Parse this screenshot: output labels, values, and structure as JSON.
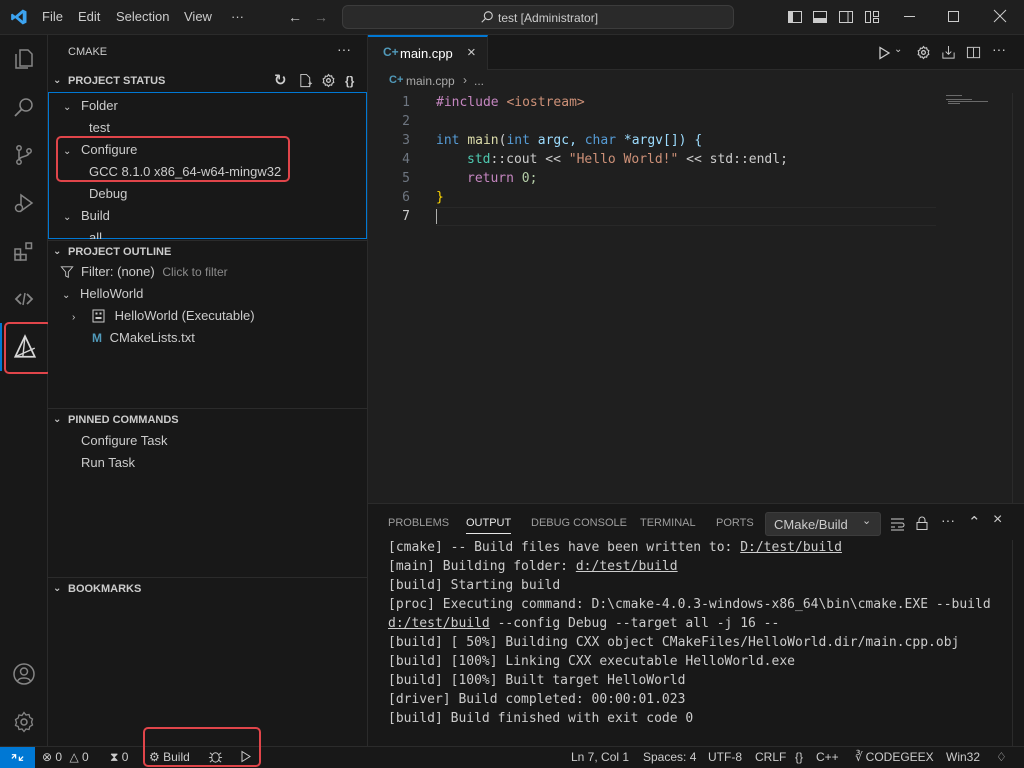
{
  "titlebar": {
    "menus": [
      "File",
      "Edit",
      "Selection",
      "View",
      "···"
    ],
    "search_text": "test [Administrator]"
  },
  "sidebar": {
    "title": "CMAKE",
    "more": "···",
    "project_status": {
      "header": "PROJECT STATUS",
      "folder_label": "Folder",
      "folder_value": "test",
      "configure_label": "Configure",
      "configure_value": "GCC 8.1.0 x86_64-w64-mingw32",
      "configure_value2": "Debug",
      "build_label": "Build",
      "build_value": "all"
    },
    "project_outline": {
      "header": "PROJECT OUTLINE",
      "filter_label": "Filter: (none)",
      "filter_hint": "Click to filter",
      "project": "HelloWorld",
      "target": "HelloWorld (Executable)",
      "file": "CMakeLists.txt"
    },
    "pinned": {
      "header": "PINNED COMMANDS",
      "items": [
        "Configure Task",
        "Run Task"
      ]
    },
    "bookmarks": {
      "header": "BOOKMARKS"
    }
  },
  "editor": {
    "tab_label": "main.cpp",
    "breadcrumb_file": "main.cpp",
    "breadcrumb_more": "...",
    "line_numbers": [
      "1",
      "2",
      "3",
      "4",
      "5",
      "6",
      "7"
    ],
    "code": {
      "l1_pre": "#include",
      "l1_inc": "<iostream>",
      "l3_int": "int",
      "l3_main": "main",
      "l3_p1": "(",
      "l3_int2": "int",
      "l3_argc": " argc, ",
      "l3_char": "char",
      "l3_argv": " *argv[]) {",
      "l4_std": "std",
      "l4_cout": "::cout << ",
      "l4_str": "\"Hello World!\"",
      "l4_rest": " << std::endl;",
      "l5_return": "return",
      "l5_zero": " 0;",
      "l6_brace": "}"
    }
  },
  "panel": {
    "tabs": [
      "PROBLEMS",
      "OUTPUT",
      "DEBUG CONSOLE",
      "TERMINAL",
      "PORTS"
    ],
    "active_tab": "OUTPUT",
    "channel": "CMake/Build",
    "output": {
      "l1a": "[cmake] -- Build files have been written to: ",
      "l1b": "D:/test/build",
      "l2a": "[main] Building folder: ",
      "l2b": "d:/test/build",
      "l3": "[build] Starting build",
      "l4": "[proc] Executing command: D:\\cmake-4.0.3-windows-x86_64\\bin\\cmake.EXE --build",
      "l5a": "d:/test/build",
      "l5b": " --config Debug --target all -j 16 --",
      "l6": "[build] [ 50%] Building CXX object CMakeFiles/HelloWorld.dir/main.cpp.obj",
      "l7": "[build] [100%] Linking CXX executable HelloWorld.exe",
      "l8": "[build] [100%] Built target HelloWorld",
      "l9": "[driver] Build completed: 00:00:01.023",
      "l10": "[build] Build finished with exit code 0"
    }
  },
  "statusbar": {
    "errors": "0",
    "warnings": "0",
    "ports": "0",
    "build": "Build",
    "position": "Ln 7, Col 1",
    "spaces": "Spaces: 4",
    "encoding": "UTF-8",
    "eol": "CRLF",
    "language": "C++",
    "codegeex": "CODEGEEX",
    "platform": "Win32"
  },
  "colors": {
    "accent": "#0078d4",
    "highlight_box": "#e0454a",
    "keyword": "#569cd6",
    "string": "#ce9178",
    "function": "#dcdcaa",
    "type_ns": "#4ec9b0",
    "preproc": "#c586c0"
  }
}
